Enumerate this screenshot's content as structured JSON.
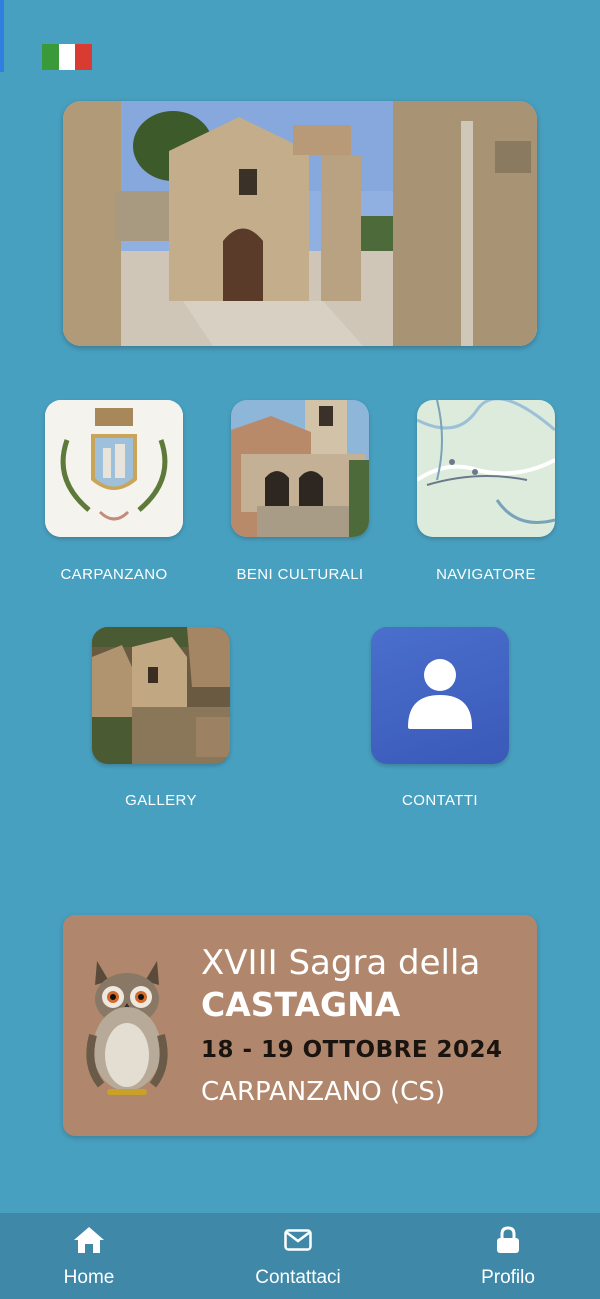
{
  "header": {
    "language_flag": "flag-italy-icon"
  },
  "tiles": [
    {
      "label": "CARPANZANO"
    },
    {
      "label": "BENI CULTURALI"
    },
    {
      "label": "NAVIGATORE"
    },
    {
      "label": "GALLERY"
    },
    {
      "label": "CONTATTI"
    }
  ],
  "banner": {
    "line1": "XVIII Sagra della",
    "line2": "CASTAGNA",
    "line3": "18 - 19 OTTOBRE 2024",
    "line4": "CARPANZANO (CS)"
  },
  "tabbar": {
    "items": [
      {
        "label": "Home",
        "icon": "home-icon"
      },
      {
        "label": "Contattaci",
        "icon": "envelope-icon"
      },
      {
        "label": "Profilo",
        "icon": "lock-icon"
      }
    ]
  },
  "colors": {
    "background": "#48a0c0",
    "tabbar": "#3f88a8",
    "contact_tile": "#4466c4",
    "banner": "#b0876c"
  }
}
